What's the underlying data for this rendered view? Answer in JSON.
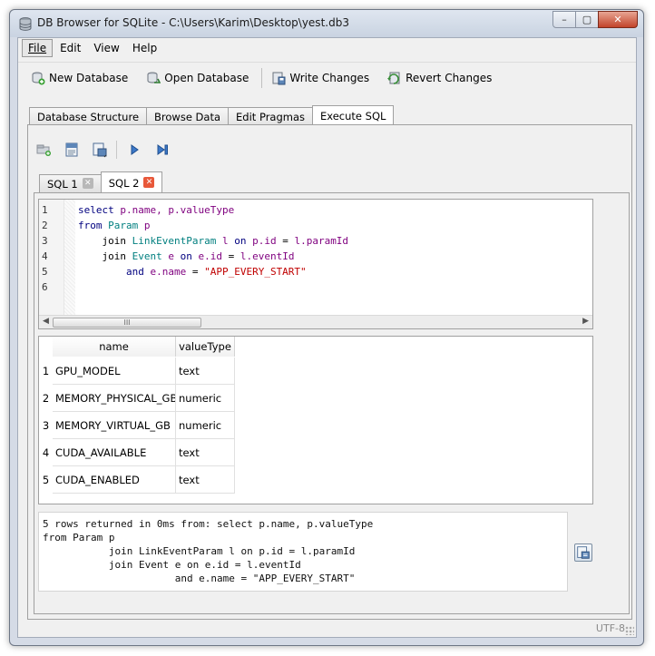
{
  "window": {
    "title": "DB Browser for SQLite - C:\\Users\\Karim\\Desktop\\yest.db3",
    "caption_buttons": {
      "minimize": "–",
      "maximize": "▢",
      "close": "✕"
    }
  },
  "menu": {
    "items": [
      {
        "label": "File",
        "underline": "F"
      },
      {
        "label": "Edit",
        "underline": "E"
      },
      {
        "label": "View",
        "underline": "V"
      },
      {
        "label": "Help",
        "underline": "H"
      }
    ]
  },
  "toolbar": {
    "new_database": "New Database",
    "open_database": "Open Database",
    "write_changes": "Write Changes",
    "revert_changes": "Revert Changes"
  },
  "main_tabs": [
    {
      "label": "Database Structure"
    },
    {
      "label": "Browse Data"
    },
    {
      "label": "Edit Pragmas"
    },
    {
      "label": "Execute SQL",
      "active": true
    }
  ],
  "sql_toolbar": {
    "icons": [
      "open-tab-icon",
      "open-sql-file-icon",
      "save-sql-file-icon",
      "execute-all-icon",
      "execute-line-icon"
    ]
  },
  "sql_tabs": [
    {
      "label": "SQL 1",
      "close": "✕"
    },
    {
      "label": "SQL 2",
      "close": "✕",
      "active": true
    }
  ],
  "editor": {
    "line_numbers": [
      "1",
      "2",
      "3",
      "4",
      "5",
      "6"
    ],
    "lines": [
      [
        {
          "t": "select ",
          "c": "kw"
        },
        {
          "t": "p.name, p.valueType",
          "c": "idp"
        }
      ],
      [
        {
          "t": "from ",
          "c": "kw"
        },
        {
          "t": "Param ",
          "c": "id"
        },
        {
          "t": "p",
          "c": "idp"
        }
      ],
      [
        {
          "t": "    join ",
          "c": "plain"
        },
        {
          "t": "LinkEventParam ",
          "c": "id"
        },
        {
          "t": "l ",
          "c": "idp"
        },
        {
          "t": "on ",
          "c": "kw"
        },
        {
          "t": "p.id ",
          "c": "idp"
        },
        {
          "t": "= ",
          "c": "plain"
        },
        {
          "t": "l.paramId",
          "c": "idp"
        }
      ],
      [
        {
          "t": "    join ",
          "c": "plain"
        },
        {
          "t": "Event ",
          "c": "id"
        },
        {
          "t": "e ",
          "c": "idp"
        },
        {
          "t": "on ",
          "c": "kw"
        },
        {
          "t": "e.id ",
          "c": "idp"
        },
        {
          "t": "= ",
          "c": "plain"
        },
        {
          "t": "l.eventId",
          "c": "idp"
        }
      ],
      [
        {
          "t": "        and ",
          "c": "kw"
        },
        {
          "t": "e.name ",
          "c": "idp"
        },
        {
          "t": "= ",
          "c": "plain"
        },
        {
          "t": "\"APP_EVERY_START\"",
          "c": "str"
        }
      ],
      []
    ],
    "scroll_grip": "III"
  },
  "results": {
    "columns": [
      "name",
      "valueType"
    ],
    "rows": [
      {
        "num": "1",
        "name": "GPU_MODEL",
        "valueType": "text"
      },
      {
        "num": "2",
        "name": "MEMORY_PHYSICAL_GB",
        "valueType": "numeric"
      },
      {
        "num": "3",
        "name": "MEMORY_VIRTUAL_GB",
        "valueType": "numeric"
      },
      {
        "num": "4",
        "name": "CUDA_AVAILABLE",
        "valueType": "text"
      },
      {
        "num": "5",
        "name": "CUDA_ENABLED",
        "valueType": "text"
      }
    ]
  },
  "messages": {
    "text": "5 rows returned in 0ms from: select p.name, p.valueType\nfrom Param p\n           join LinkEventParam l on p.id = l.paramId\n           join Event e on e.id = l.eventId\n                      and e.name = \"APP_EVERY_START\""
  },
  "status": {
    "encoding": "UTF-8"
  },
  "colors": {
    "keyword": "#00007f",
    "identifier": "#007f7f",
    "alias": "#7f007f",
    "string": "#c00000",
    "close_red": "#e8583a"
  }
}
